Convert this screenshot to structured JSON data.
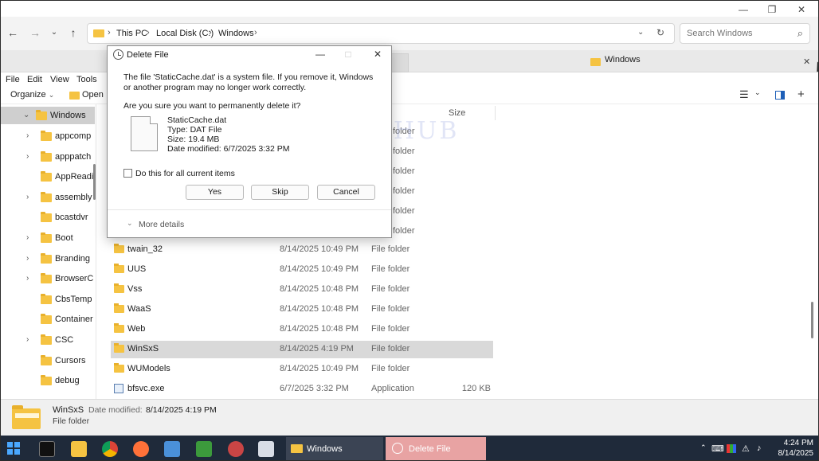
{
  "window": {
    "minimize": "—",
    "restore": "❐",
    "close": "✕"
  },
  "address": {
    "crumbs": [
      "This PC",
      "Local Disk (C:)",
      "Windows"
    ],
    "search_placeholder": "Search Windows"
  },
  "tabs": {
    "active_label": "Windows"
  },
  "menu": [
    "File",
    "Edit",
    "View",
    "Tools"
  ],
  "commands": {
    "organize": "Organize",
    "open": "Open"
  },
  "nav": {
    "selected": "Windows",
    "items": [
      "appcomp",
      "apppatch",
      "AppReadi",
      "assembly",
      "bcastdvr",
      "Boot",
      "Branding",
      "BrowserC",
      "CbsTemp",
      "Container",
      "CSC",
      "Cursors",
      "debug"
    ]
  },
  "columns": {
    "size": "Size"
  },
  "partial_rows": [
    "folder",
    "folder",
    "folder",
    "folder",
    "folder",
    "folder"
  ],
  "files": [
    {
      "name": "twain_32",
      "date": "8/14/2025 10:49 PM",
      "type": "File folder",
      "size": ""
    },
    {
      "name": "UUS",
      "date": "8/14/2025 10:49 PM",
      "type": "File folder",
      "size": ""
    },
    {
      "name": "Vss",
      "date": "8/14/2025 10:48 PM",
      "type": "File folder",
      "size": ""
    },
    {
      "name": "WaaS",
      "date": "8/14/2025 10:48 PM",
      "type": "File folder",
      "size": ""
    },
    {
      "name": "Web",
      "date": "8/14/2025 10:48 PM",
      "type": "File folder",
      "size": ""
    },
    {
      "name": "WinSxS",
      "date": "8/14/2025 4:19 PM",
      "type": "File folder",
      "size": ""
    },
    {
      "name": "WUModels",
      "date": "8/14/2025 10:49 PM",
      "type": "File folder",
      "size": ""
    },
    {
      "name": "bfsvc.exe",
      "date": "6/7/2025 3:32 PM",
      "type": "Application",
      "size": "120 KB"
    }
  ],
  "watermark": "IT Pros HUB",
  "details": {
    "name": "WinSxS",
    "modified_label": "Date modified:",
    "modified_value": "8/14/2025 4:19 PM",
    "type": "File folder"
  },
  "dialog": {
    "title": "Delete File",
    "message": "The file 'StaticCache.dat' is a system file. If you remove it, Windows or another program may no longer work correctly.",
    "question": "Are you sure you want to permanently delete it?",
    "file_name": "StaticCache.dat",
    "file_type": "Type: DAT File",
    "file_size": "Size: 19.4 MB",
    "file_modified": "Date modified: 6/7/2025 3:32 PM",
    "checkbox_label": "Do this for all current items",
    "yes": "Yes",
    "skip": "Skip",
    "cancel": "Cancel",
    "more_details": "More details"
  },
  "taskbar": {
    "windows_label": "Windows",
    "delete_label": "Delete File",
    "time": "4:24 PM",
    "date": "8/14/2025"
  },
  "colors": {
    "folder": "#f5c342",
    "taskbar": "#1f2a3a",
    "delete_task": "#e8a3a3"
  }
}
